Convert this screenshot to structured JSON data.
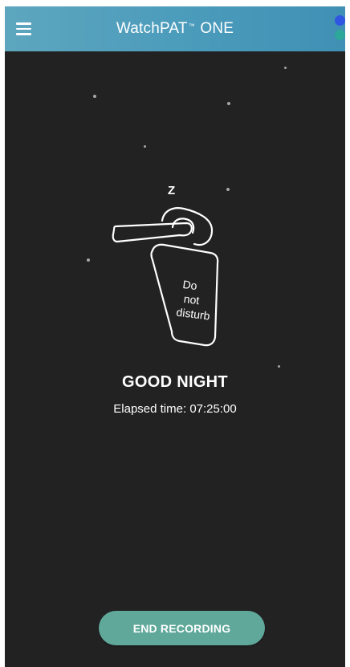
{
  "app_bar": {
    "title": "WatchPAT",
    "trademark": "™",
    "title_suffix": "ONE",
    "menu_icon": "hamburger-menu-icon",
    "status_colors": [
      "#2f56e0",
      "#2da89a"
    ]
  },
  "illustration": {
    "icon": "do-not-disturb-door-hanger",
    "sleep_letter": "Z",
    "sign_lines": [
      "Do",
      "not",
      "disturb"
    ]
  },
  "main": {
    "headline": "GOOD NIGHT",
    "elapsed_label": "Elapsed time:",
    "elapsed_value": "07:25:00"
  },
  "footer": {
    "end_button_label": "END RECORDING"
  }
}
